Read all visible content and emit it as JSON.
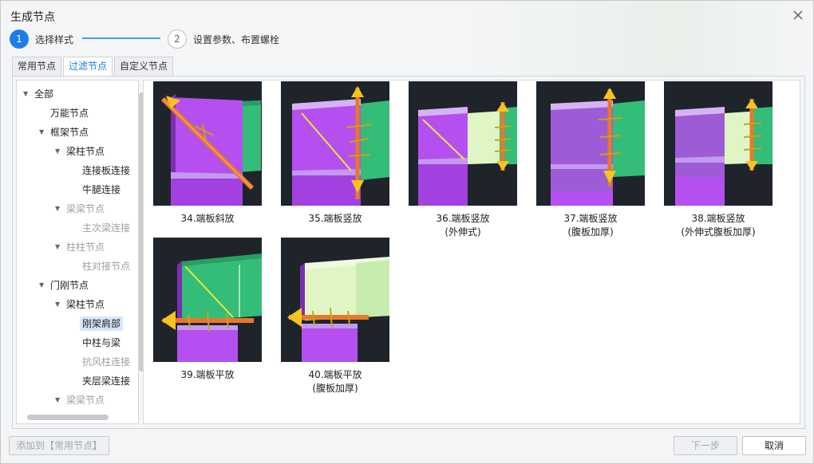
{
  "window": {
    "title": "生成节点"
  },
  "steps": [
    {
      "num": "1",
      "label": "选择样式"
    },
    {
      "num": "2",
      "label": "设置参数、布置螺栓"
    }
  ],
  "tabs": [
    {
      "label": "常用节点"
    },
    {
      "label": "过滤节点"
    },
    {
      "label": "自定义节点"
    }
  ],
  "tree": [
    {
      "label": "全部"
    },
    {
      "label": "万能节点"
    },
    {
      "label": "框架节点"
    },
    {
      "label": "梁柱节点"
    },
    {
      "label": "连接板连接"
    },
    {
      "label": "牛腿连接"
    },
    {
      "label": "梁梁节点"
    },
    {
      "label": "主次梁连接"
    },
    {
      "label": "柱柱节点"
    },
    {
      "label": "柱对接节点"
    },
    {
      "label": "门刚节点"
    },
    {
      "label": "梁柱节点"
    },
    {
      "label": "刚架肩部"
    },
    {
      "label": "中柱与梁"
    },
    {
      "label": "抗风柱连接"
    },
    {
      "label": "夹层梁连接"
    },
    {
      "label": "梁梁节点"
    }
  ],
  "cards": [
    {
      "line1": "34.端板斜放",
      "line2": ""
    },
    {
      "line1": "35.端板竖放",
      "line2": ""
    },
    {
      "line1": "36.端板竖放",
      "line2": "(外伸式)"
    },
    {
      "line1": "37.端板竖放",
      "line2": "(腹板加厚)"
    },
    {
      "line1": "38.端板竖放",
      "line2": "(外伸式腹板加厚)"
    },
    {
      "line1": "39.端板平放",
      "line2": ""
    },
    {
      "line1": "40.端板平放",
      "line2": "(腹板加厚)"
    }
  ],
  "footer": {
    "add_label": "添加到【常用节点】",
    "next_label": "下一步",
    "cancel_label": "取消"
  },
  "colors": {
    "accent": "#1d7de8",
    "column": "#b44cf0",
    "beam": "#3cc07a",
    "plate": "#e8782a",
    "bolt": "#f7c31e",
    "thumb_bg": "#1f242b"
  }
}
